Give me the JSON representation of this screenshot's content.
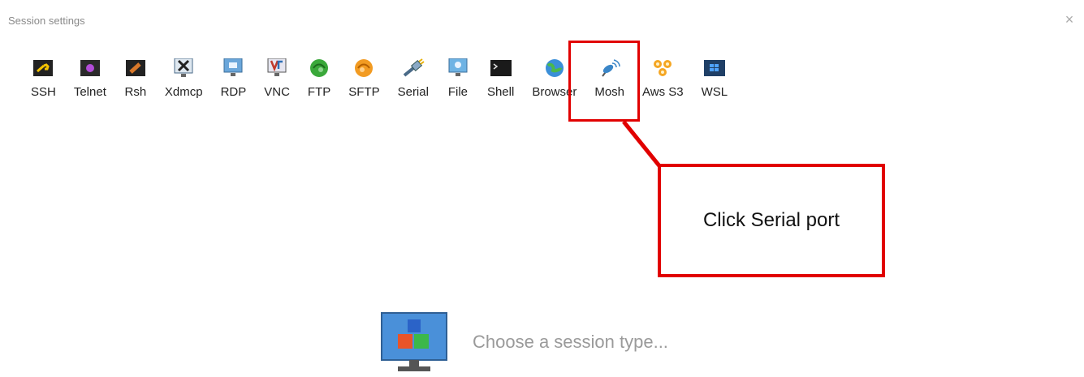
{
  "window": {
    "title": "Session settings",
    "close_glyph": "×"
  },
  "session_types": [
    {
      "label": "SSH",
      "icon": "key-icon"
    },
    {
      "label": "Telnet",
      "icon": "telnet-icon"
    },
    {
      "label": "Rsh",
      "icon": "rsh-icon"
    },
    {
      "label": "Xdmcp",
      "icon": "xdmcp-icon"
    },
    {
      "label": "RDP",
      "icon": "rdp-monitor-icon"
    },
    {
      "label": "VNC",
      "icon": "vnc-icon"
    },
    {
      "label": "FTP",
      "icon": "ftp-globe-icon"
    },
    {
      "label": "SFTP",
      "icon": "sftp-globe-icon"
    },
    {
      "label": "Serial",
      "icon": "serial-plug-icon"
    },
    {
      "label": "File",
      "icon": "file-monitor-icon"
    },
    {
      "label": "Shell",
      "icon": "terminal-icon"
    },
    {
      "label": "Browser",
      "icon": "browser-globe-icon"
    },
    {
      "label": "Mosh",
      "icon": "satellite-icon"
    },
    {
      "label": "Aws S3",
      "icon": "aws-s3-icon"
    },
    {
      "label": "WSL",
      "icon": "windows-icon"
    }
  ],
  "annotation": {
    "text": "Click Serial port",
    "color": "#e10000"
  },
  "placeholder": {
    "text": "Choose a session type..."
  }
}
